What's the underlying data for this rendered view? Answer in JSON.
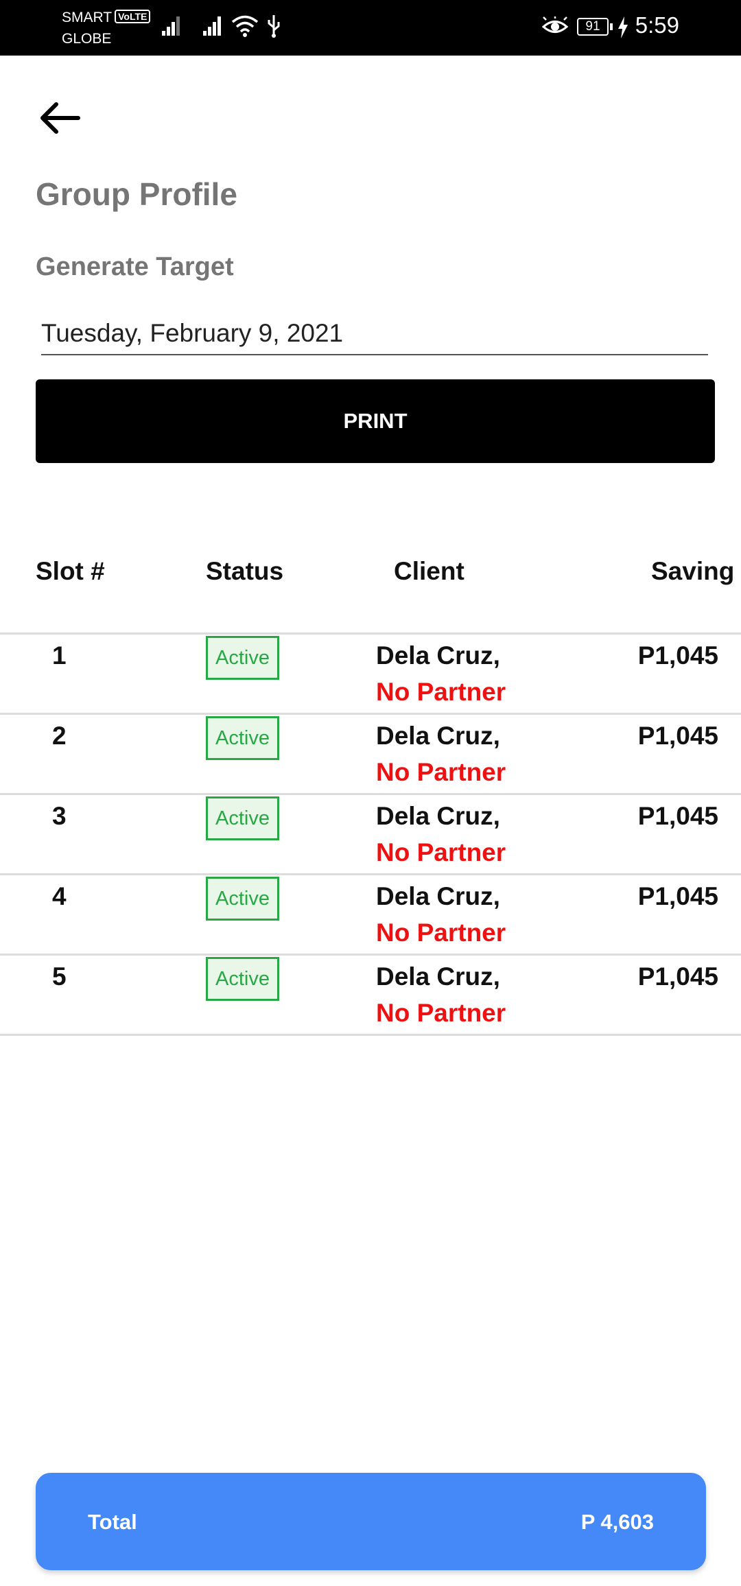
{
  "status_bar": {
    "carrier1": "SMART",
    "volte": "VoLTE",
    "carrier2": "GLOBE",
    "battery": "91",
    "time": "5:59"
  },
  "header": {
    "title": "Group Profile",
    "section_label": "Generate Target"
  },
  "date_field": {
    "value": "Tuesday, February 9, 2021"
  },
  "print_button": {
    "label": "PRINT"
  },
  "table": {
    "columns": [
      "Slot #",
      "Status",
      "Client",
      "Saving"
    ],
    "rows": [
      {
        "slot": "1",
        "status": "Active",
        "client": "Dela Cruz,",
        "partner": "No Partner",
        "saving": "P1,045"
      },
      {
        "slot": "2",
        "status": "Active",
        "client": "Dela Cruz,",
        "partner": "No Partner",
        "saving": "P1,045"
      },
      {
        "slot": "3",
        "status": "Active",
        "client": "Dela Cruz,",
        "partner": "No Partner",
        "saving": "P1,045"
      },
      {
        "slot": "4",
        "status": "Active",
        "client": "Dela Cruz,",
        "partner": "No Partner",
        "saving": "P1,045"
      },
      {
        "slot": "5",
        "status": "Active",
        "client": "Dela Cruz,",
        "partner": "No Partner",
        "saving": "P1,045"
      }
    ]
  },
  "total": {
    "label": "Total",
    "value": "P 4,603"
  },
  "colors": {
    "status_bar": "#000000",
    "title_gray": "#757575",
    "print_button": "#000000",
    "active_green": "#28a745",
    "no_partner_red": "#ee1111",
    "total_bar": "#4489f7"
  },
  "icons": [
    "signal-icon",
    "wifi-icon",
    "usb-icon",
    "eye-icon",
    "battery-icon",
    "charging-icon",
    "back-arrow-icon"
  ]
}
